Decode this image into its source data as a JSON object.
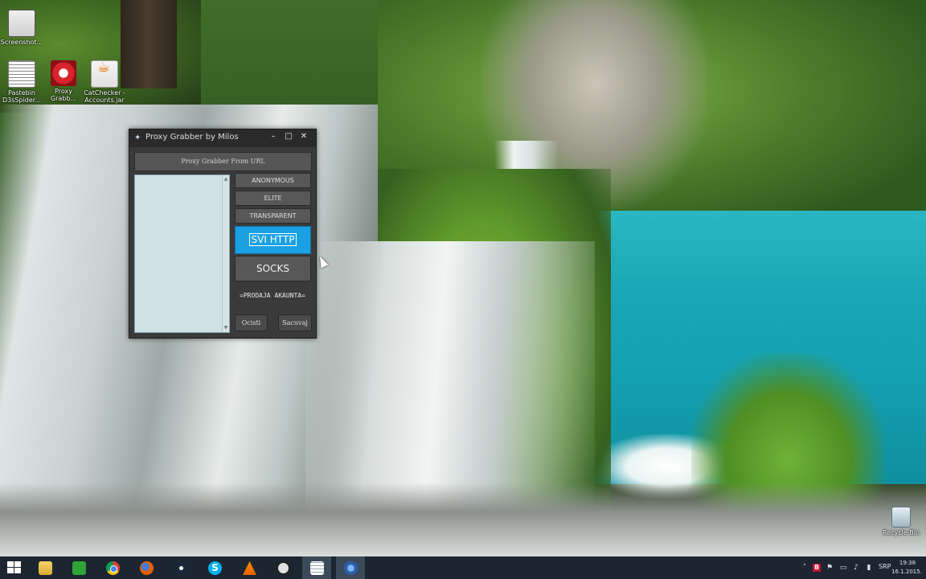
{
  "desktop": {
    "icons": [
      {
        "label": "Screenshot...",
        "icon": "screenshot-icon"
      },
      {
        "label": "Pastebin D3sSpider...",
        "icon": "pastebin-icon"
      },
      {
        "label": "Proxy Grabb...",
        "icon": "proxy-grabber-icon"
      },
      {
        "label": "CatChecker - Accounts.jar",
        "icon": "java-icon"
      },
      {
        "label": "Recycle Bin",
        "icon": "recycle-bin-icon"
      }
    ]
  },
  "window": {
    "title": "Proxy Grabber by Milos",
    "url_button": "Proxy Grabber From URL",
    "buttons": {
      "anonymous": "ANONYMOUS",
      "elite": "ELITE",
      "transparent": "TRANSPARENT",
      "svi_http": "SVI HTTP",
      "socks": "SOCKS"
    },
    "prodaja": "=PRODAJA AKAUNTA=",
    "ocisti": "Ocisti",
    "sacuvaj": "Sacuvaj",
    "controls": {
      "minimize": "–",
      "maximize": "□",
      "close": "✕"
    },
    "accent_color": "#1ba1e2"
  },
  "taskbar": {
    "apps": [
      "start",
      "file-explorer",
      "store",
      "chrome",
      "firefox",
      "steam",
      "skype",
      "vlc",
      "obs",
      "notepad",
      "proxy-grabber"
    ],
    "tray": {
      "language": "SRP",
      "time": "19:38",
      "date": "16.1.2015."
    }
  }
}
